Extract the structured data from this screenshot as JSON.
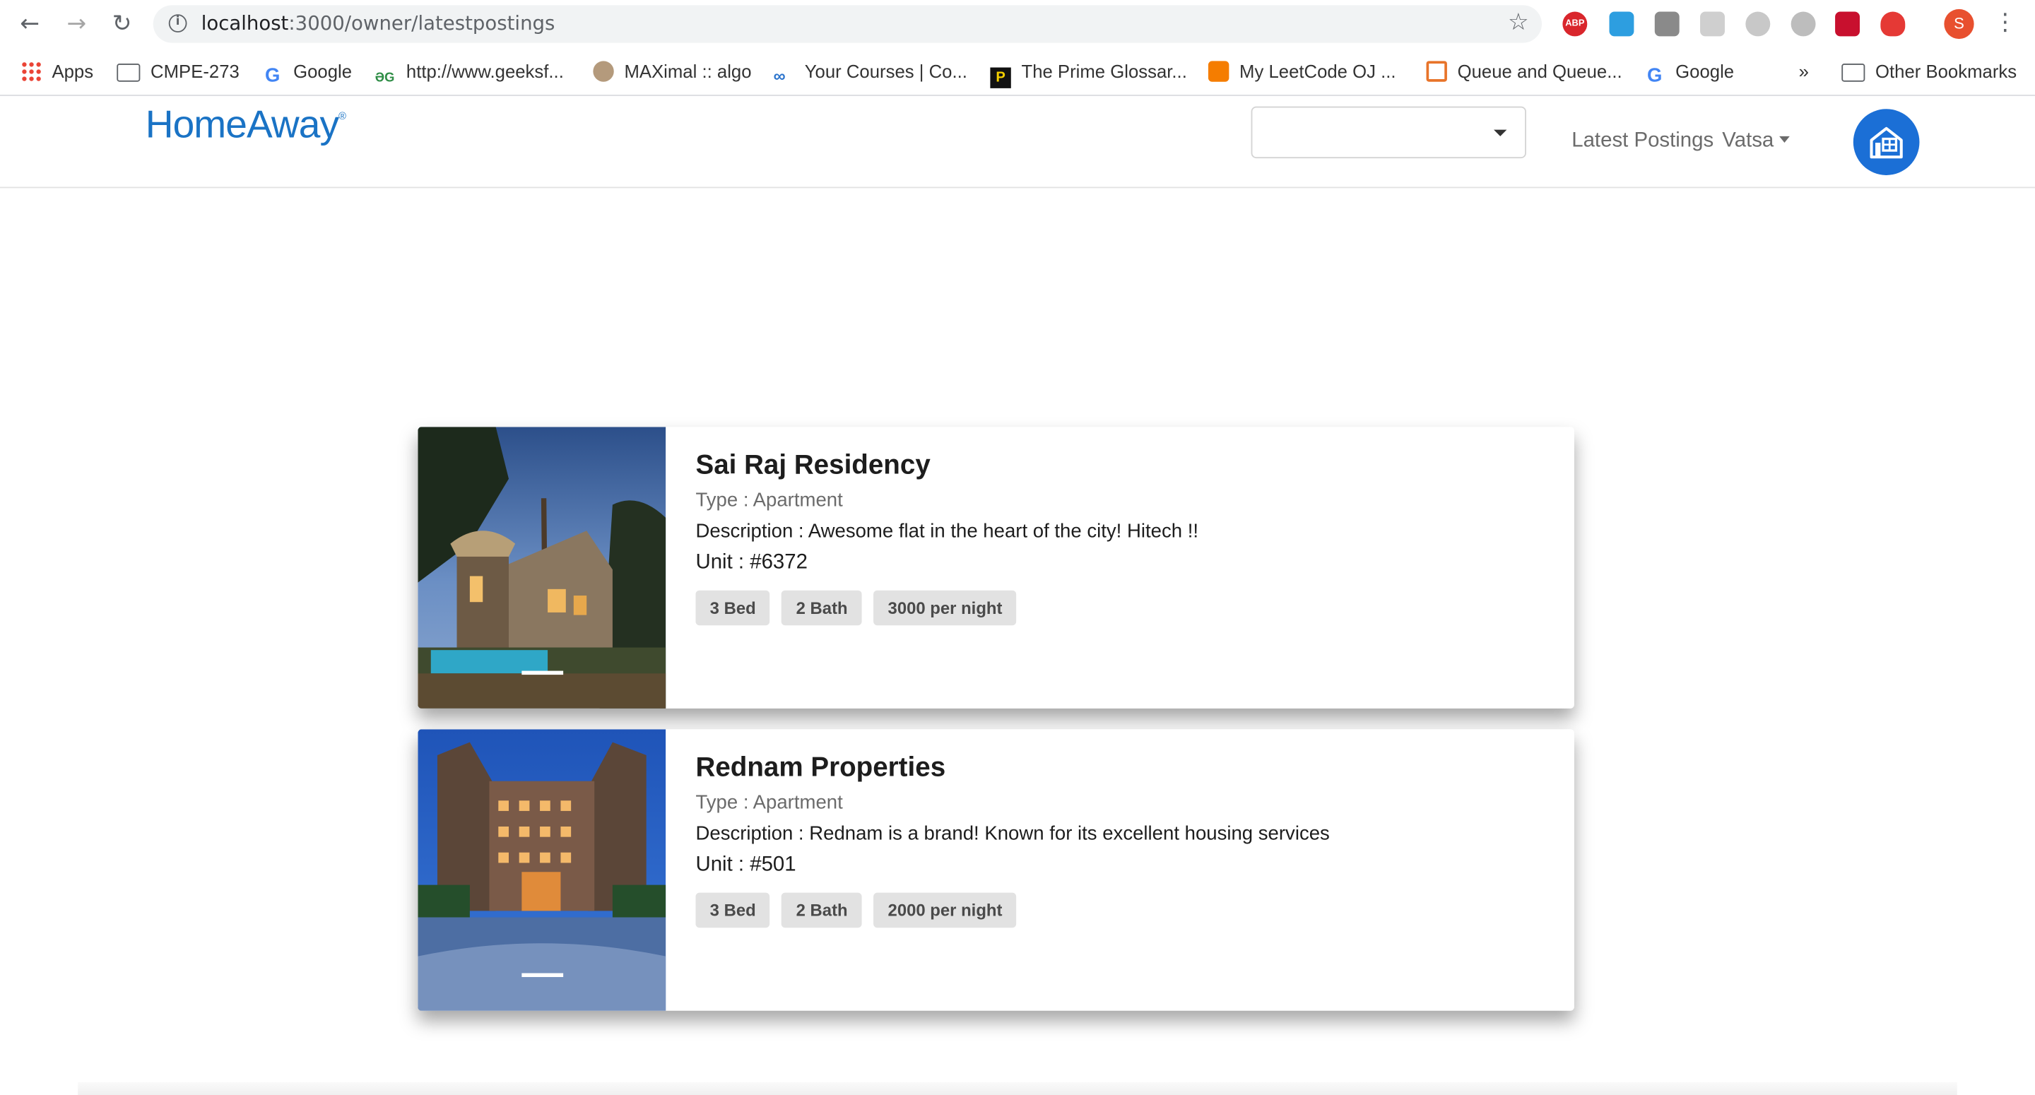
{
  "browser": {
    "url_host": "localhost",
    "url_path": ":3000/owner/latestpostings",
    "profile_initial": "S"
  },
  "bookmarks": [
    {
      "label": "Apps",
      "icon": "apps-grid-icon"
    },
    {
      "label": "CMPE-273",
      "icon": "folder-icon"
    },
    {
      "label": "Google",
      "icon": "google-icon"
    },
    {
      "label": "http://www.geeksf...",
      "icon": "geeksforgeeks-icon"
    },
    {
      "label": "MAXimal :: algo",
      "icon": "maximal-icon"
    },
    {
      "label": "Your Courses | Co...",
      "icon": "coursera-icon"
    },
    {
      "label": "The Prime Glossar...",
      "icon": "prime-icon"
    },
    {
      "label": "My LeetCode OJ ...",
      "icon": "blogger-icon"
    },
    {
      "label": "Queue and Queue...",
      "icon": "queue-icon"
    },
    {
      "label": "Google",
      "icon": "google-icon"
    }
  ],
  "bookmarks_overflow": "»",
  "other_bookmarks": "Other Bookmarks",
  "navbar": {
    "logo": "HomeAway",
    "logo_mark": "®",
    "select_value": "",
    "latest_postings": "Latest Postings",
    "user": "Vatsa"
  },
  "listings": [
    {
      "title": "Sai Raj Residency",
      "type": "Type : Apartment",
      "description": "Description : Awesome flat in the heart of the city! Hitech !!",
      "unit": "Unit : #6372",
      "beds": "3 Bed",
      "baths": "2 Bath",
      "price": "3000 per night"
    },
    {
      "title": "Rednam Properties",
      "type": "Type : Apartment",
      "description": "Description : Rednam is a brand! Known for its excellent housing services",
      "unit": "Unit : #501",
      "beds": "3 Bed",
      "baths": "2 Bath",
      "price": "2000 per night"
    }
  ],
  "colors": {
    "brand": "#1a73c5",
    "badge_bg": "#e2e2e2",
    "home_badge": "#1b6fd6"
  }
}
